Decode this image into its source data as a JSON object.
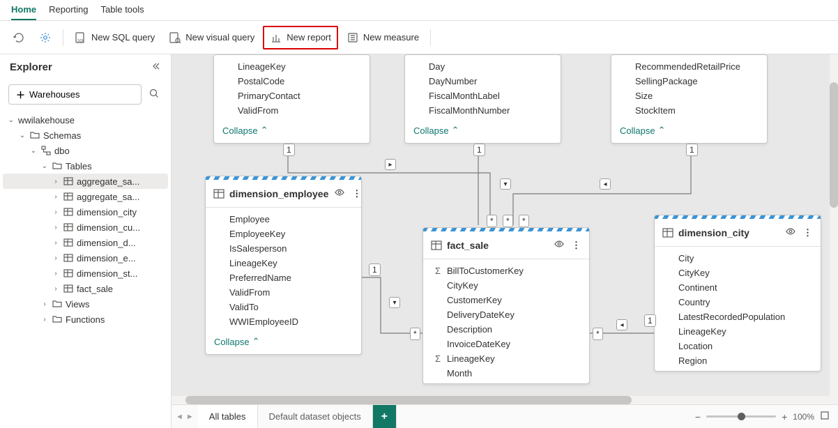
{
  "tabs": {
    "home": "Home",
    "reporting": "Reporting",
    "table_tools": "Table tools"
  },
  "toolbar": {
    "new_sql_query": "New SQL query",
    "new_visual_query": "New visual query",
    "new_report": "New report",
    "new_measure": "New measure"
  },
  "explorer": {
    "title": "Explorer",
    "warehouses_btn": "Warehouses",
    "root": "wwilakehouse",
    "schemas": "Schemas",
    "dbo": "dbo",
    "tables_label": "Tables",
    "tables": [
      "aggregate_sa...",
      "aggregate_sa...",
      "dimension_city",
      "dimension_cu...",
      "dimension_d...",
      "dimension_e...",
      "dimension_st...",
      "fact_sale"
    ],
    "views": "Views",
    "functions": "Functions"
  },
  "cards": {
    "collapse": "Collapse",
    "top1": {
      "fields": [
        "LineageKey",
        "PostalCode",
        "PrimaryContact",
        "ValidFrom"
      ]
    },
    "top2": {
      "fields": [
        "Day",
        "DayNumber",
        "FiscalMonthLabel",
        "FiscalMonthNumber"
      ]
    },
    "top3": {
      "fields": [
        "RecommendedRetailPrice",
        "SellingPackage",
        "Size",
        "StockItem"
      ]
    },
    "emp": {
      "title": "dimension_employee",
      "fields": [
        "Employee",
        "EmployeeKey",
        "IsSalesperson",
        "LineageKey",
        "PreferredName",
        "ValidFrom",
        "ValidTo",
        "WWIEmployeeID"
      ]
    },
    "fact": {
      "title": "fact_sale",
      "fields": [
        "BillToCustomerKey",
        "CityKey",
        "CustomerKey",
        "DeliveryDateKey",
        "Description",
        "InvoiceDateKey",
        "LineageKey",
        "Month"
      ],
      "sigma": [
        0,
        6
      ]
    },
    "city": {
      "title": "dimension_city",
      "fields": [
        "City",
        "CityKey",
        "Continent",
        "Country",
        "LatestRecordedPopulation",
        "LineageKey",
        "Location",
        "Region"
      ]
    }
  },
  "rel": {
    "one": "1",
    "many": "*"
  },
  "bottom": {
    "all_tables": "All tables",
    "default_dataset": "Default dataset objects",
    "zoom": "100%"
  }
}
